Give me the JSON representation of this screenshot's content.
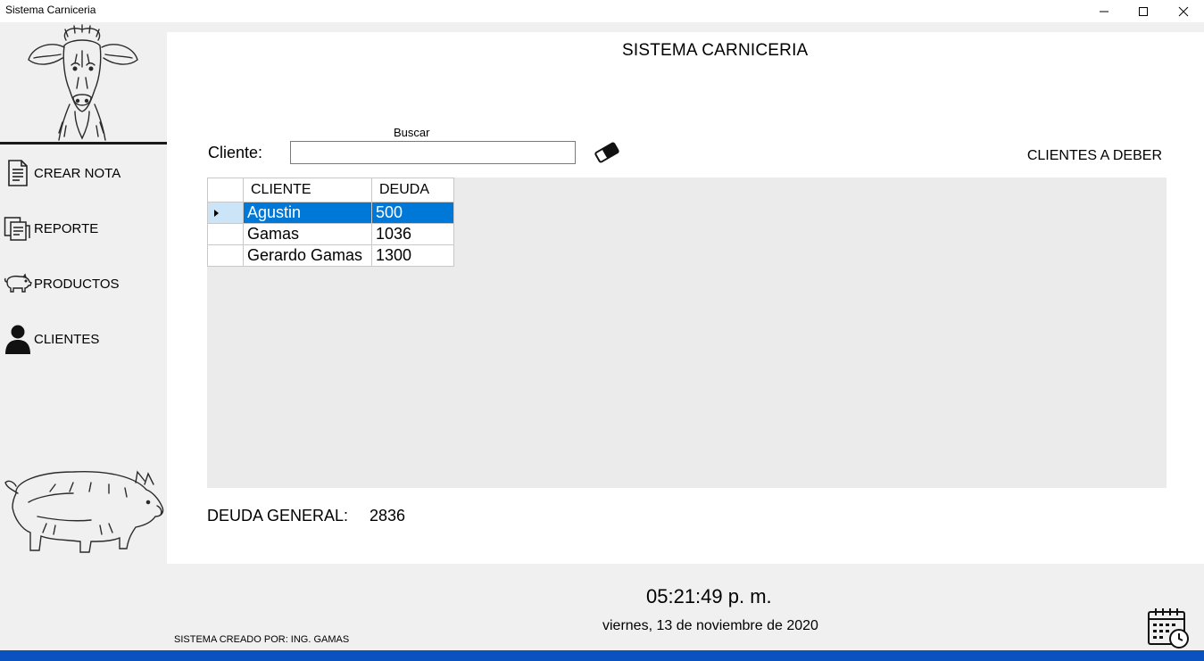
{
  "window": {
    "title": "Sistema Carniceria"
  },
  "sidebar": {
    "items": [
      {
        "label": "CREAR NOTA",
        "icon": "document-icon"
      },
      {
        "label": "REPORTE",
        "icon": "report-icon"
      },
      {
        "label": "PRODUCTOS",
        "icon": "pig-icon"
      },
      {
        "label": "CLIENTES",
        "icon": "user-icon"
      }
    ]
  },
  "main": {
    "title": "SISTEMA CARNICERIA",
    "search": {
      "caption": "Buscar",
      "label": "Cliente:",
      "value": ""
    },
    "debtors_label": "CLIENTES A DEBER",
    "table": {
      "columns": [
        "CLIENTE",
        "DEUDA"
      ],
      "rows": [
        {
          "cliente": "Agustin",
          "deuda": "500",
          "selected": true
        },
        {
          "cliente": "Gamas",
          "deuda": "1036",
          "selected": false
        },
        {
          "cliente": "Gerardo Gamas",
          "deuda": "1300",
          "selected": false
        }
      ]
    },
    "deuda_general": {
      "label": "DEUDA GENERAL:",
      "value": "2836"
    }
  },
  "footer": {
    "time": "05:21:49 p. m.",
    "date": "viernes, 13 de noviembre de 2020",
    "credits": "SISTEMA CREADO POR: ING. GAMAS"
  },
  "colors": {
    "selection": "#0078d7",
    "taskbar": "#0a52c0",
    "panel": "#f0f0f0"
  }
}
